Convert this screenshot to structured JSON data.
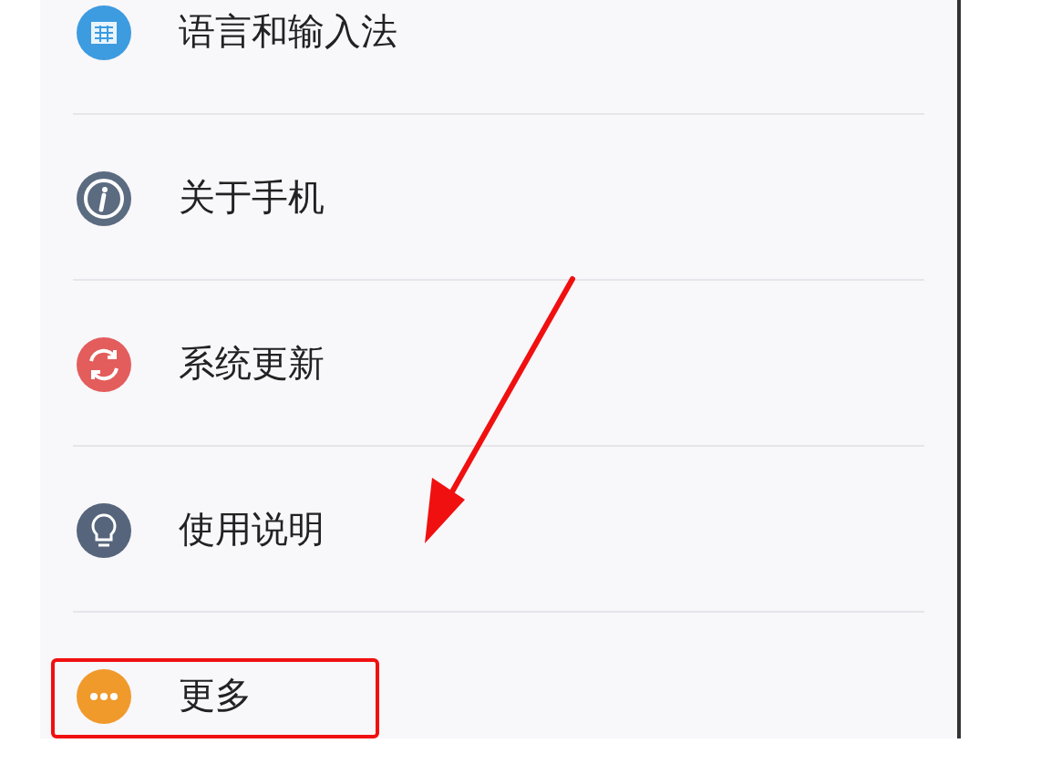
{
  "settings_list": [
    {
      "label": "语言和输入法",
      "kind": "keyboard",
      "color": "#3d9be0",
      "highlighted": false
    },
    {
      "label": "关于手机",
      "kind": "info",
      "color": "#5b6b80",
      "highlighted": false
    },
    {
      "label": "系统更新",
      "kind": "refresh",
      "color": "#e35d5d",
      "highlighted": false
    },
    {
      "label": "使用说明",
      "kind": "bulb",
      "color": "#56657b",
      "highlighted": false
    },
    {
      "label": "更多",
      "kind": "more",
      "color": "#f09a2c",
      "highlighted": true
    }
  ]
}
